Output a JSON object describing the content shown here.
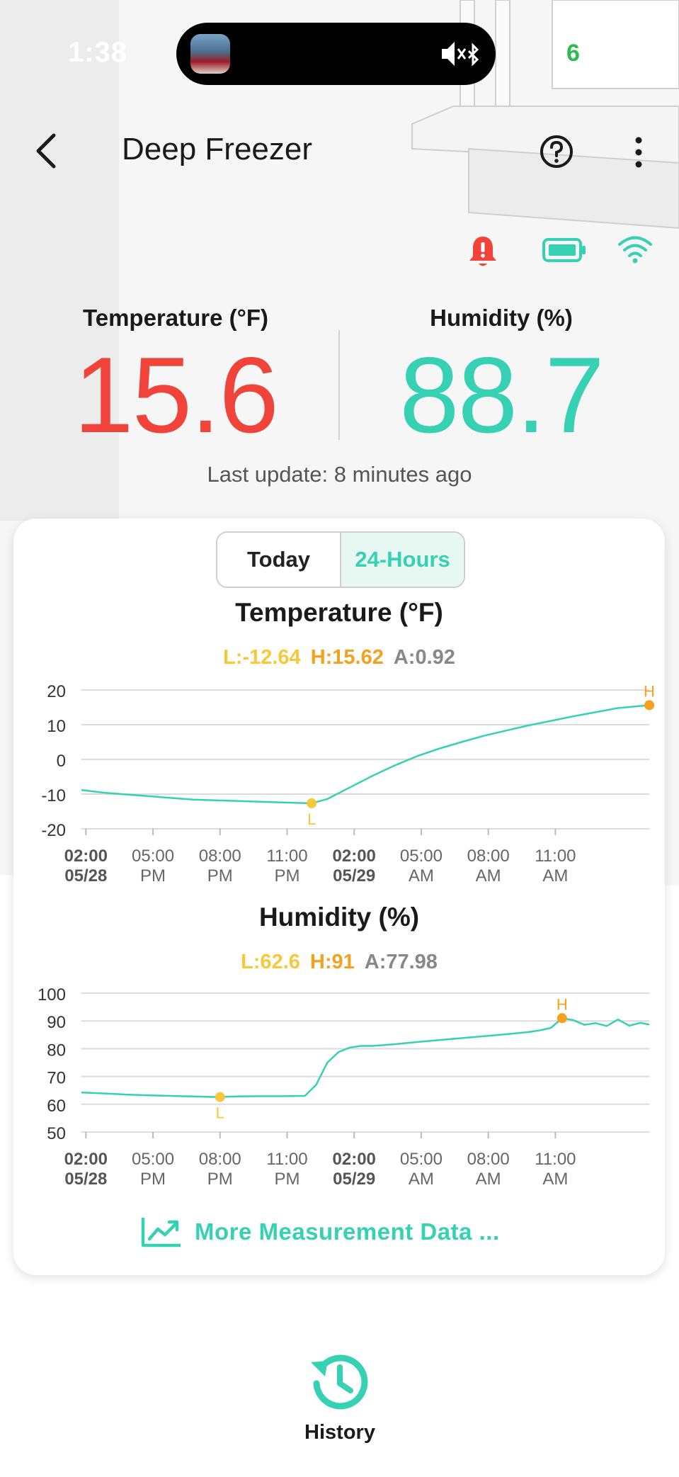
{
  "status_bar": {
    "time": "1:38"
  },
  "header": {
    "title": "Deep Freezer"
  },
  "readouts": {
    "temperature": {
      "label": "Temperature (°F)",
      "value": "15.6",
      "color": "#f0443a"
    },
    "humidity": {
      "label": "Humidity (%)",
      "value": "88.7",
      "color": "#36d1b3"
    },
    "last_update": "Last update: 8 minutes ago"
  },
  "status_icons": [
    "alarm-bell-icon",
    "battery-icon",
    "wifi-icon"
  ],
  "tabs": [
    {
      "label": "Today",
      "selected": false
    },
    {
      "label": "24-Hours",
      "selected": true
    }
  ],
  "x_ticks": [
    {
      "line1": "02:00",
      "line2": "05/28",
      "bold": true
    },
    {
      "line1": "05:00",
      "line2": "PM",
      "bold": false
    },
    {
      "line1": "08:00",
      "line2": "PM",
      "bold": false
    },
    {
      "line1": "11:00",
      "line2": "PM",
      "bold": false
    },
    {
      "line1": "02:00",
      "line2": "05/29",
      "bold": true
    },
    {
      "line1": "05:00",
      "line2": "AM",
      "bold": false
    },
    {
      "line1": "08:00",
      "line2": "AM",
      "bold": false
    },
    {
      "line1": "11:00",
      "line2": "AM",
      "bold": false
    }
  ],
  "chart_data": [
    {
      "type": "line",
      "title": "Temperature (°F)",
      "stats": {
        "low": "L:-12.64",
        "high": "H:15.62",
        "avg": "A:0.92"
      },
      "marker_low": "L",
      "marker_high": "H",
      "ylim": [
        -20,
        20
      ],
      "yticks": [
        20,
        10,
        0,
        -10,
        -20
      ],
      "xlim": [
        0,
        25.4
      ],
      "x_ticks_hours": [
        0.2,
        3.2,
        6.2,
        9.2,
        12.2,
        15.2,
        18.2,
        21.2
      ],
      "line_color": "#36d1b3",
      "x": [
        0,
        1,
        2,
        3,
        4,
        5,
        6,
        7,
        8,
        9,
        10,
        10.3,
        11,
        12,
        13,
        14,
        15,
        16,
        17,
        18,
        19,
        20,
        21,
        22,
        23,
        24,
        25.4
      ],
      "y": [
        -8.8,
        -9.6,
        -10.1,
        -10.6,
        -11.1,
        -11.6,
        -11.8,
        -12.0,
        -12.2,
        -12.4,
        -12.6,
        -12.64,
        -11.4,
        -8.1,
        -4.8,
        -1.8,
        0.9,
        3.1,
        5.0,
        6.8,
        8.3,
        9.8,
        11.1,
        12.4,
        13.6,
        14.8,
        15.62
      ],
      "low_point": {
        "x": 10.3,
        "y": -12.64
      },
      "high_point": {
        "x": 25.4,
        "y": 15.62
      }
    },
    {
      "type": "line",
      "title": "Humidity (%)",
      "stats": {
        "low": "L:62.6",
        "high": "H:91",
        "avg": "A:77.98"
      },
      "marker_low": "L",
      "marker_high": "H",
      "ylim": [
        50,
        100
      ],
      "yticks": [
        100,
        90,
        80,
        70,
        60,
        50
      ],
      "xlim": [
        0,
        25.4
      ],
      "x_ticks_hours": [
        0.2,
        3.2,
        6.2,
        9.2,
        12.2,
        15.2,
        18.2,
        21.2
      ],
      "line_color": "#36d1b3",
      "x": [
        0,
        1,
        2,
        3,
        4,
        5,
        6,
        7,
        8,
        9,
        10,
        10.5,
        11,
        11.5,
        12,
        12.5,
        13,
        14,
        15,
        16,
        17,
        18,
        19,
        20,
        20.5,
        21,
        21.5,
        22,
        22.5,
        23,
        23.5,
        24,
        24.5,
        25,
        25.4
      ],
      "y": [
        64.2,
        63.9,
        63.5,
        63.2,
        63.0,
        62.8,
        62.6,
        62.8,
        62.9,
        62.9,
        63.0,
        67.0,
        75.0,
        78.8,
        80.4,
        81.0,
        81.0,
        81.6,
        82.4,
        83.1,
        83.8,
        84.5,
        85.2,
        86.0,
        86.6,
        87.5,
        91.0,
        90.3,
        88.6,
        89.2,
        88.2,
        90.5,
        88.3,
        89.3,
        88.7
      ],
      "low_point": {
        "x": 6.2,
        "y": 62.6
      },
      "high_point": {
        "x": 21.5,
        "y": 91.0
      }
    }
  ],
  "more_data": {
    "label": "More Measurement Data ..."
  },
  "bottom_nav": {
    "history_label": "History"
  },
  "colors": {
    "accent": "#36d1b3",
    "alert": "#f0443a",
    "low_marker": "#f8c83c",
    "high_marker": "#f5a11d"
  }
}
